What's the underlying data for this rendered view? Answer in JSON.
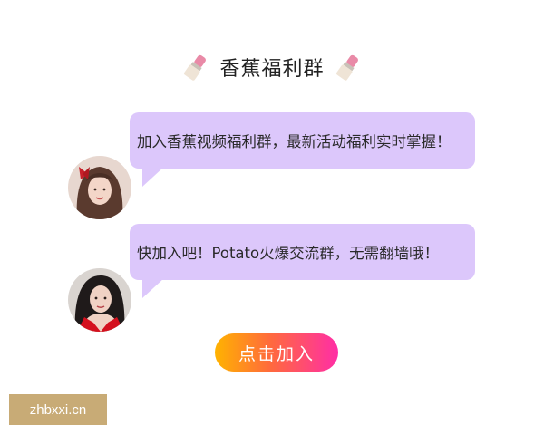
{
  "header": {
    "title": "香蕉福利群",
    "left_icon": "lipstick-icon",
    "right_icon": "lipstick-icon"
  },
  "messages": [
    {
      "text": "加入香蕉视频福利群，最新活动福利实时掌握！",
      "avatar": "avatar-girl-red-bow"
    },
    {
      "text": "快加入吧！Potato火爆交流群，无需翻墙哦！",
      "avatar": "avatar-girl-red-dress"
    }
  ],
  "cta": {
    "label": "点击加入"
  },
  "watermark": {
    "text": "zhbxxi.cn"
  },
  "colors": {
    "bubble": "#dcc7fb",
    "button_start": "#ffb300",
    "button_end": "#ff2ea6",
    "watermark_bg": "#c8ab76"
  }
}
